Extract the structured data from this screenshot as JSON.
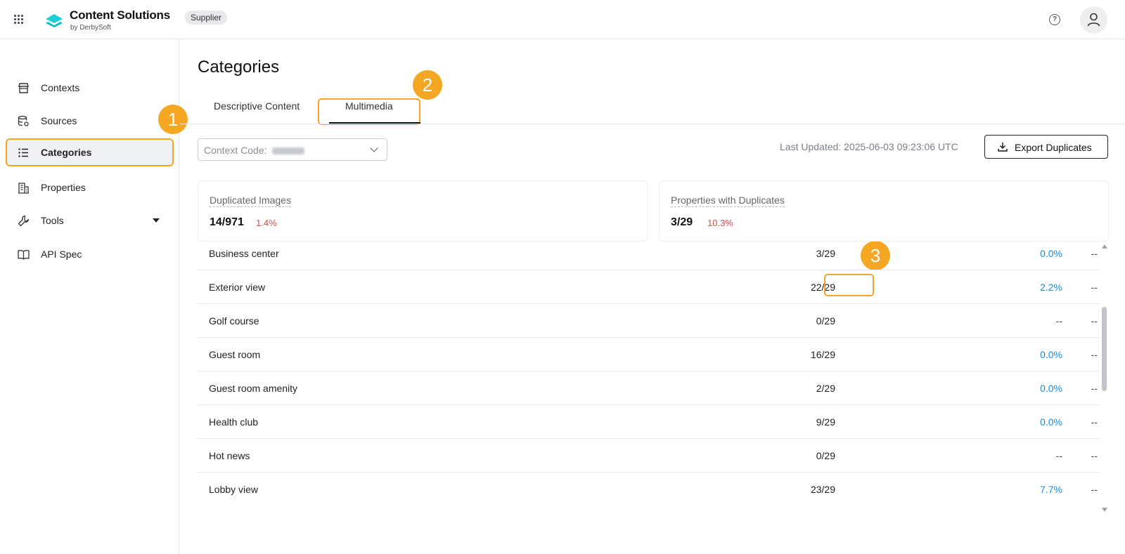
{
  "header": {
    "brand_title": "Content Solutions",
    "brand_sub": "by DerbySoft",
    "role_badge": "Supplier",
    "help_glyph": "?",
    "icons": {
      "apps": "apps-grid-icon",
      "logo": "content-solutions-logo-icon",
      "help": "help-icon",
      "user": "user-icon"
    },
    "brand_color": "#1ccfd6"
  },
  "sidebar": {
    "items": [
      {
        "label": "Contexts",
        "icon": "store-icon",
        "active": false
      },
      {
        "label": "Sources",
        "icon": "database-settings-icon",
        "active": false
      },
      {
        "label": "Categories",
        "icon": "list-icon",
        "active": true
      },
      {
        "label": "Properties",
        "icon": "building-icon",
        "active": false
      },
      {
        "label": "Tools",
        "icon": "wrench-icon",
        "active": false,
        "expandable": true
      },
      {
        "label": "API Spec",
        "icon": "book-icon",
        "active": false
      }
    ]
  },
  "callouts": {
    "one": "1",
    "two": "2",
    "three": "3",
    "color": "#f5a623"
  },
  "main": {
    "title": "Categories",
    "tabs": [
      {
        "label": "Descriptive Content",
        "selected": false
      },
      {
        "label": "Multimedia",
        "selected": true
      }
    ],
    "context_select": {
      "label": "Context Code:",
      "value_redacted": true
    },
    "last_updated": "Last Updated: 2025-06-03 09:23:06 UTC",
    "export_button": "Export Duplicates",
    "stats": [
      {
        "label": "Duplicated Images",
        "value": "14/971",
        "percent": "1.4%"
      },
      {
        "label": "Properties with Duplicates",
        "value": "3/29",
        "percent": "10.3%"
      }
    ],
    "rows": [
      {
        "name": "Business center",
        "ratio": "3/29",
        "pct": "0.0%",
        "last": "--"
      },
      {
        "name": "Exterior view",
        "ratio": "22/29",
        "pct": "2.2%",
        "last": "--"
      },
      {
        "name": "Golf course",
        "ratio": "0/29",
        "pct": "--",
        "last": "--"
      },
      {
        "name": "Guest room",
        "ratio": "16/29",
        "pct": "0.0%",
        "last": "--"
      },
      {
        "name": "Guest room amenity",
        "ratio": "2/29",
        "pct": "0.0%",
        "last": "--"
      },
      {
        "name": "Health club",
        "ratio": "9/29",
        "pct": "0.0%",
        "last": "--"
      },
      {
        "name": "Hot news",
        "ratio": "0/29",
        "pct": "--",
        "last": "--"
      },
      {
        "name": "Lobby view",
        "ratio": "23/29",
        "pct": "7.7%",
        "last": "--"
      }
    ],
    "percent_color": "#1a8bd8",
    "alert_color": "#e0484a"
  }
}
